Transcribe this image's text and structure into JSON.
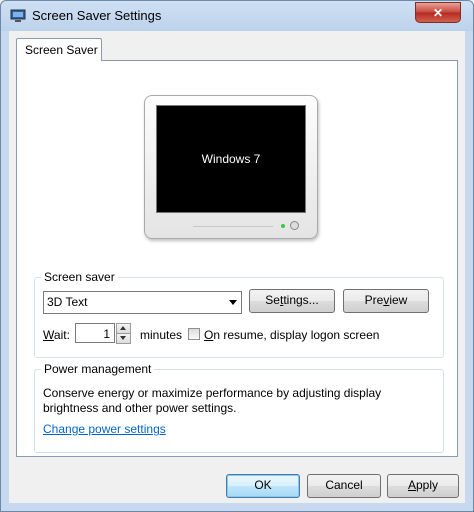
{
  "window": {
    "title": "Screen Saver Settings",
    "close_label": "✕"
  },
  "tabs": [
    {
      "label": "Screen Saver",
      "selected": true
    }
  ],
  "preview": {
    "screen_text": "Windows 7"
  },
  "screen_saver": {
    "group_label": "Screen saver",
    "selected": "3D Text",
    "settings_button": {
      "before": "Se",
      "key": "t",
      "after": "tings..."
    },
    "preview_button": {
      "before": "Pre",
      "key": "v",
      "after": "iew"
    },
    "wait_label": {
      "key": "W",
      "after": "ait:"
    },
    "wait_value": "1",
    "minutes_label": "minutes",
    "on_resume": {
      "key": "O",
      "after": "n resume, display logon screen",
      "checked": false
    }
  },
  "power": {
    "group_label": "Power management",
    "description_line1": "Conserve energy or maximize performance by adjusting display",
    "description_line2": "brightness and other power settings.",
    "link_text": "Change power settings"
  },
  "buttons": {
    "ok": "OK",
    "cancel": "Cancel",
    "apply": {
      "key": "A",
      "after": "pply"
    }
  },
  "colors": {
    "link": "#0066cc",
    "close_button": "#c7453a",
    "default_button_border": "#3c7fb1"
  }
}
